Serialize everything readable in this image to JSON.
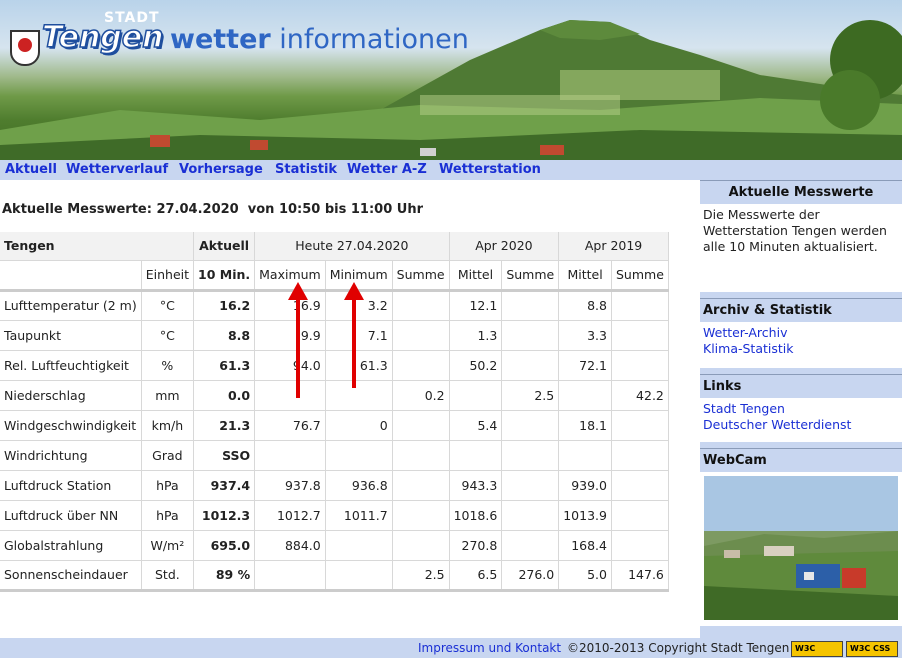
{
  "header": {
    "stadt": "STADT",
    "town": "Tengen",
    "title_bold": "wetter",
    "title_rest": " informationen"
  },
  "nav": [
    "Aktuell",
    "Wetterverlauf",
    "Vorhersage",
    "Statistik",
    "Wetter A-Z",
    "Wetterstation"
  ],
  "main": {
    "title": "Aktuelle Messwerte: 27.04.2020  von 10:50 bis 11:00 Uhr",
    "table": {
      "group_headers": [
        "Tengen",
        "Aktuell",
        "Heute 27.04.2020",
        "Apr 2020",
        "Apr 2019"
      ],
      "sub_headers": [
        "",
        "Einheit",
        "10 Min.",
        "Maximum",
        "Minimum",
        "Summe",
        "Mittel",
        "Summe",
        "Mittel",
        "Summe"
      ],
      "rows": [
        [
          "Lufttemperatur (2 m)",
          "°C",
          "16.2",
          "16.9",
          "3.2",
          "",
          "12.1",
          "",
          "8.8",
          ""
        ],
        [
          "Taupunkt",
          "°C",
          "8.8",
          "9.9",
          "7.1",
          "",
          "1.3",
          "",
          "3.3",
          ""
        ],
        [
          "Rel. Luftfeuchtigkeit",
          "%",
          "61.3",
          "94.0",
          "61.3",
          "",
          "50.2",
          "",
          "72.1",
          ""
        ],
        [
          "Niederschlag",
          "mm",
          "0.0",
          "",
          "",
          "0.2",
          "",
          "2.5",
          "",
          "42.2"
        ],
        [
          "Windgeschwindigkeit",
          "km/h",
          "21.3",
          "76.7",
          "0",
          "",
          "5.4",
          "",
          "18.1",
          ""
        ],
        [
          "Windrichtung",
          "Grad",
          "SSO",
          "",
          "",
          "",
          "",
          "",
          "",
          ""
        ],
        [
          "Luftdruck Station",
          "hPa",
          "937.4",
          "937.8",
          "936.8",
          "",
          "943.3",
          "",
          "939.0",
          ""
        ],
        [
          "Luftdruck über NN",
          "hPa",
          "1012.3",
          "1012.7",
          "1011.7",
          "",
          "1018.6",
          "",
          "1013.9",
          ""
        ],
        [
          "Globalstrahlung",
          "W/m²",
          "695.0",
          "884.0",
          "",
          "",
          "270.8",
          "",
          "168.4",
          ""
        ],
        [
          "Sonnenscheindauer",
          "Std.",
          "89 %",
          "",
          "",
          "2.5",
          "6.5",
          "276.0",
          "5.0",
          "147.6"
        ]
      ]
    }
  },
  "sidebar": {
    "messwerte": {
      "title": "Aktuelle Messwerte",
      "text": "Die Messwerte der Wetterstation Tengen werden alle 10 Minuten aktualisiert."
    },
    "archiv": {
      "title": "Archiv & Statistik",
      "links": [
        "Wetter-Archiv",
        "Klima-Statistik"
      ]
    },
    "links": {
      "title": "Links",
      "links": [
        "Stadt Tengen",
        "Deutscher Wetterdienst"
      ]
    },
    "webcam": {
      "title": "WebCam"
    }
  },
  "footer": {
    "impressum": "Impressum und Kontakt",
    "copyright": "©2010-2013 Copyright Stadt Tengen",
    "badge_xhtml": "W3C XHTML 1.0",
    "badge_css": "W3C CSS level2"
  },
  "colors": {
    "nav_bg": "#c8d6f0",
    "link": "#1a2fd4",
    "title_blue": "#2f66c4",
    "arrow": "#e00000"
  }
}
